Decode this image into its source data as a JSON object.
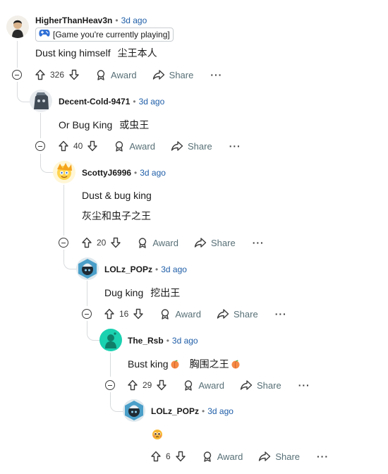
{
  "comments": [
    {
      "username": "HigherThanHeav3n",
      "time": "3d ago",
      "flair": "[Game you're currently playing]",
      "body_en": "Dust king himself",
      "body_cjk": "尘王本人",
      "votes": "326",
      "award": "Award",
      "share": "Share",
      "more": "···"
    },
    {
      "username": "Decent-Cold-9471",
      "time": "3d ago",
      "body_en": "Or Bug King",
      "body_cjk": "或虫王",
      "votes": "40",
      "award": "Award",
      "share": "Share",
      "more": "···"
    },
    {
      "username": "ScottyJ6996",
      "time": "3d ago",
      "body_line1": "Dust & bug king",
      "body_line2": "灰尘和虫子之王",
      "votes": "20",
      "award": "Award",
      "share": "Share",
      "more": "···"
    },
    {
      "username": "LOLz_POPz",
      "time": "3d ago",
      "body_en": "Dug king",
      "body_cjk": "挖出王",
      "votes": "16",
      "award": "Award",
      "share": "Share",
      "more": "···"
    },
    {
      "username": "The_Rsb",
      "time": "3d ago",
      "body_en": "Bust king",
      "body_cjk": "胸围之王",
      "votes": "29",
      "award": "Award",
      "share": "Share",
      "more": "···"
    },
    {
      "username": "LOLz_POPz",
      "time": "3d ago",
      "votes": "6",
      "award": "Award",
      "share": "Share",
      "more": "···"
    }
  ],
  "separator": "•",
  "colors": {
    "link": "#1f5ea8",
    "muted": "#576f76",
    "thread": "#d7dadc"
  }
}
